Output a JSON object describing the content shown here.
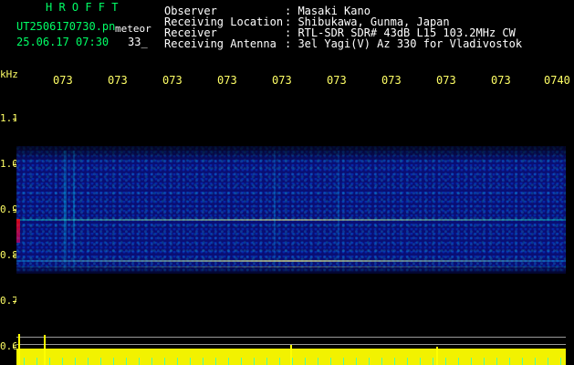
{
  "header": {
    "site_code": "H R O F F T",
    "filename": "UT2506170730.pn",
    "meteor_label": "meteor",
    "date_time": "25.06.17 07:30",
    "count": "33_",
    "observer_label": "Observer",
    "observer_value": ": Masaki Kano",
    "receiving_location_label": "Receiving Location",
    "receiving_location_value": ": Shibukawa, Gunma, Japan",
    "receiver_label": "Receiver",
    "receiver_value": ": RTL-SDR SDR# 43dB L15 103.2MHz CW",
    "receiving_antenna_label": "Receiving Antenna",
    "receiving_antenna_value": ": 3el Yagi(V) Az 330 for Vladivostok"
  },
  "axes": {
    "x_unit": "kHz",
    "time_ticks": [
      "073",
      "073",
      "073",
      "073",
      "073",
      "073",
      "073",
      "073",
      "073",
      "0740"
    ],
    "y_ticks": [
      "1.1",
      "1.0",
      "0.9",
      "0.8",
      "0.7",
      "0.6"
    ]
  },
  "colors": {
    "title": "#00ff66",
    "text": "#ffffff",
    "ticks": "#ffff66",
    "spectrogram_base": "#0b0f7a",
    "activity": "#ffff00",
    "cyan": "#00ffff",
    "red_mark": "#ff0000"
  }
}
